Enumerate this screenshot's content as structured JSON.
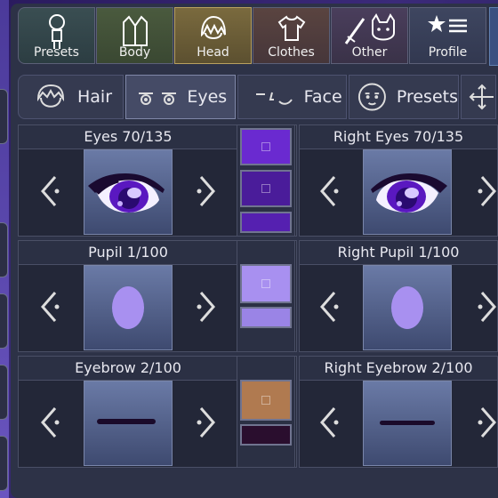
{
  "top_tabs": [
    {
      "label": "Presets",
      "icon": "character-icon"
    },
    {
      "label": "Body",
      "icon": "jacket-icon"
    },
    {
      "label": "Head",
      "icon": "hair-icon",
      "active": true
    },
    {
      "label": "Clothes",
      "icon": "shirt-icon"
    },
    {
      "label": "Other",
      "icon": "sword-cat-icon"
    },
    {
      "label": "Profile",
      "icon": "star-list-icon"
    }
  ],
  "sub_tabs": [
    {
      "label": "Hair",
      "icon": "hair-face-icon"
    },
    {
      "label": "Eyes",
      "icon": "eyes-icon",
      "active": true
    },
    {
      "label": "Face",
      "icon": "face-icon"
    },
    {
      "label": "Presets",
      "icon": "face-circle-icon"
    },
    {
      "label": "",
      "icon": "move-icon"
    }
  ],
  "cells": {
    "eyes": {
      "title": "Eyes 70/135"
    },
    "right_eyes": {
      "title": "Right Eyes 70/135"
    },
    "pupil": {
      "title": "Pupil 1/100"
    },
    "right_pupil": {
      "title": "Right Pupil 1/100"
    },
    "eyebrow": {
      "title": "Eyebrow 2/100"
    },
    "right_eyebrow": {
      "title": "Right Eyebrow 2/100"
    }
  },
  "colors": {
    "eye_color_1": "#6a2ad0",
    "eye_color_2": "#4a1c9a",
    "eye_color_3": "#5520b0",
    "pupil_color_1": "#a890f0",
    "pupil_color_2": "#9a84e6",
    "eyebrow_color_1": "#b07a50",
    "eyebrow_color_2": "#2a0e2e",
    "accent_head": "#b8a060"
  }
}
